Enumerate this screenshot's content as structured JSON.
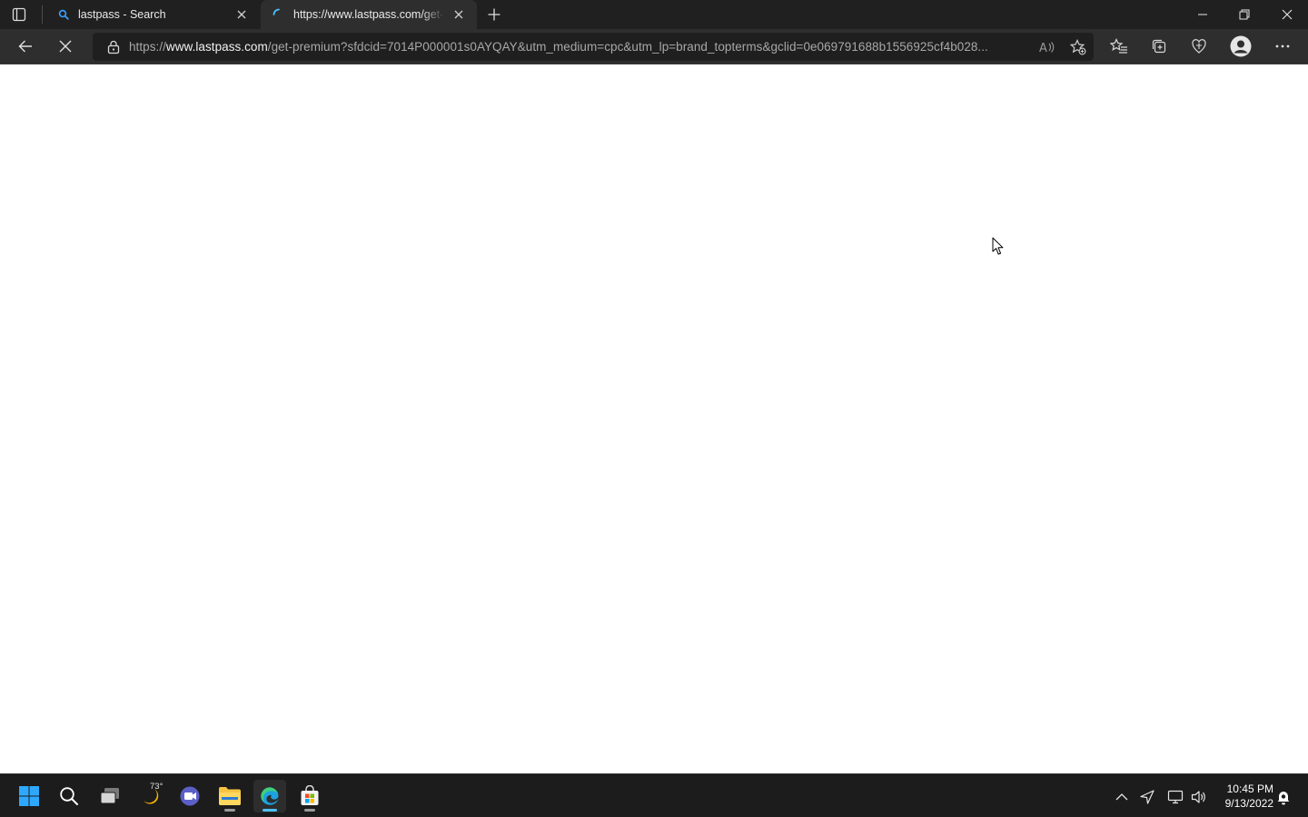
{
  "browser": {
    "tabs": [
      {
        "title": "lastpass - Search",
        "favicon": "search-icon",
        "active": false
      },
      {
        "title": "https://www.lastpass.com/get-premium",
        "favicon": "loading-spinner-icon",
        "active": true
      }
    ],
    "address_bar": {
      "url_prefix": "https://",
      "url_host": "www.lastpass.com",
      "url_rest": "/get-premium?sfdcid=7014P000001s0AYQAY&utm_medium=cpc&utm_lp=brand_topterms&gclid=0e069791688b1556925cf4b028..."
    },
    "loading": true
  },
  "taskbar": {
    "weather_temp": "73°",
    "clock_time": "10:45 PM",
    "clock_date": "9/13/2022"
  },
  "colors": {
    "titlebar": "#202020",
    "toolbar": "#2e2e2e",
    "taskbar": "#1c1c1c",
    "accent": "#4cc2ff"
  }
}
